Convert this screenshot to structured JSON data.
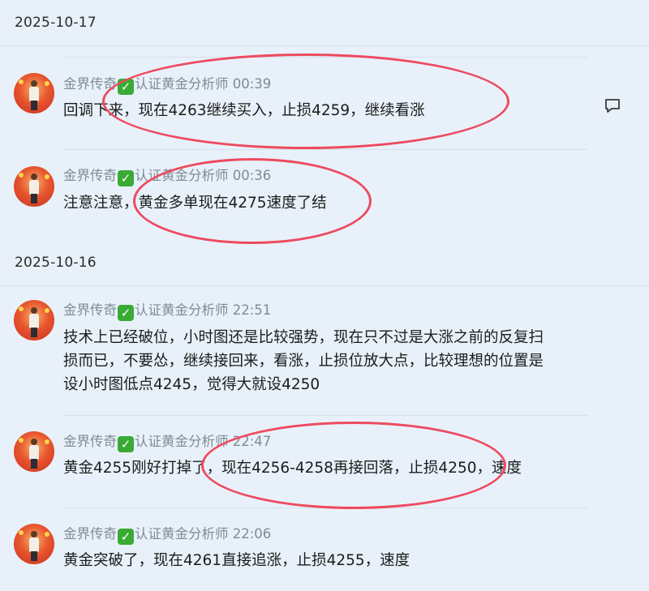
{
  "date_groups": [
    {
      "date": "2025-10-17",
      "messages": [
        {
          "author": "金界传奇",
          "badge_icon": "check-mark-icon",
          "role": "认证黄金分析师",
          "time": "00:39",
          "text": "回调下来，现在4263继续买入，止损4259，继续看涨"
        },
        {
          "author": "金界传奇",
          "badge_icon": "check-mark-icon",
          "role": "认证黄金分析师",
          "time": "00:36",
          "text": "注意注意，黄金多单现在4275速度了结"
        }
      ]
    },
    {
      "date": "2025-10-16",
      "messages": [
        {
          "author": "金界传奇",
          "badge_icon": "check-mark-icon",
          "role": "认证黄金分析师",
          "time": "22:51",
          "text": "技术上已经破位，小时图还是比较强势，现在只不过是大涨之前的反复扫损而已，不要怂，继续接回来，看涨，止损位放大点，比较理想的位置是设小时图低点4245，觉得大就设4250"
        },
        {
          "author": "金界传奇",
          "badge_icon": "check-mark-icon",
          "role": "认证黄金分析师",
          "time": "22:47",
          "text": "黄金4255刚好打掉了，现在4256-4258再接回落，止损4250，速度"
        },
        {
          "author": "金界传奇",
          "badge_icon": "check-mark-icon",
          "role": "认证黄金分析师",
          "time": "22:06",
          "text": "黄金突破了，现在4261直接追涨，止损4255，速度"
        }
      ]
    }
  ],
  "reply_icon": "comment-bubble-icon",
  "colors": {
    "background": "#e8f1f9",
    "highlight": "#ee4a5f",
    "badge": "#3aaa35",
    "meta_text": "#7e8b96"
  }
}
